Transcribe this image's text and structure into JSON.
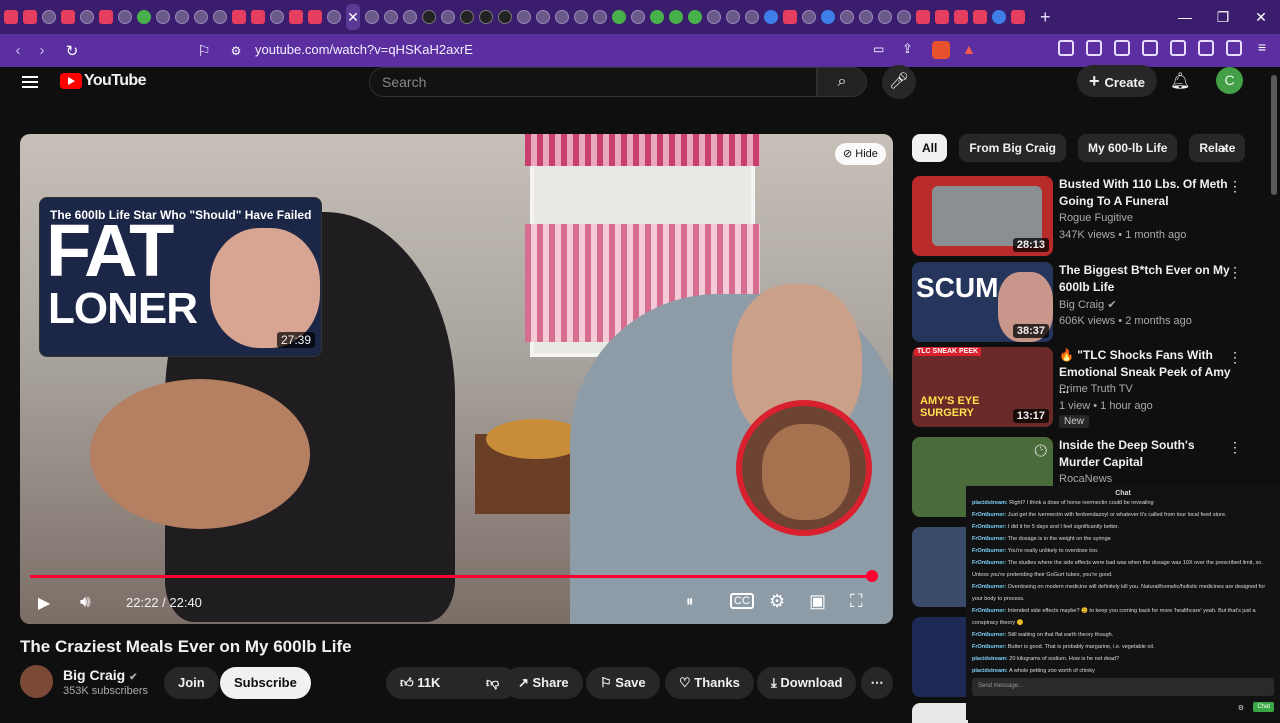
{
  "browser": {
    "url": "youtube.com/watch?v=qHSKaH2axrE",
    "new_tab": "+",
    "window_controls": [
      "—",
      "❐",
      "✕"
    ]
  },
  "header": {
    "logo": "YouTube",
    "search_placeholder": "Search",
    "create": "Create",
    "avatar_letter": "C"
  },
  "player": {
    "hide_label": "Hide",
    "overlay_title": "The 600lb Life Star Who \"Should\" Have Failed",
    "overlay_big1": "FAT",
    "overlay_big2": "LONER",
    "overlay_duration": "27:39",
    "time": "22:22 / 22:40",
    "progress": 0.986
  },
  "video": {
    "title": "The Craziest Meals Ever on My 600lb Life",
    "channel": "Big Craig",
    "subscribers": "353K subscribers",
    "join": "Join",
    "subscribe": "Subscribe",
    "likes": "11K",
    "share": "Share",
    "save": "Save",
    "thanks": "Thanks",
    "download": "Download"
  },
  "chips": [
    "All",
    "From Big Craig",
    "My 600-lb Life",
    "Relate"
  ],
  "recommendations": [
    {
      "title": "Busted With 110 Lbs. Of Meth Going To A Funeral",
      "channel": "Rogue Fugitive",
      "meta": "347K views • 1 month ago",
      "duration": "28:13",
      "thumb_color": "#b92a2a"
    },
    {
      "title": "The Biggest B*tch Ever on My 600lb Life",
      "channel": "Big Craig",
      "meta": "606K views • 2 months ago",
      "duration": "38:37",
      "thumb_color": "#25355c",
      "thumb_text": "SCUM"
    },
    {
      "title": "🔥 \"TLC Shocks Fans With Emotional Sneak Peek of Amy ...",
      "channel": "Prime Truth TV",
      "meta": "1 view • 1 hour ago",
      "duration": "13:17",
      "badge": "New",
      "thumb_color": "#a33",
      "thumb_text": "AMY'S EYE SURGERY",
      "thumb_tag": "TLC SNEAK PEEK"
    },
    {
      "title": "Inside the Deep South's Murder Capital",
      "channel": "RocaNews",
      "meta": "",
      "duration": "",
      "thumb_color": "#4a6b3a"
    }
  ],
  "chat": {
    "title": "Chat",
    "messages": [
      {
        "user": "placidstream:",
        "text": "Right? I think a dose of horse ivermectin could be revealing"
      },
      {
        "user": "FrOntburner:",
        "text": "Just get the ivermectin with fenbendazoyl or whatever it's called from tour local feed store."
      },
      {
        "user": "FrOntburner:",
        "text": "I did it for 5 days and I feel significantly better."
      },
      {
        "user": "FrOntburner:",
        "text": "The dosage is in the weight on the syringe"
      },
      {
        "user": "FrOntburner:",
        "text": "You're really unlikely to overdose too."
      },
      {
        "user": "FrOntburner:",
        "text": "The studies where the side effects were bad was when the dosage was 10X over the prescribed limit, so. Unless you're pretending their GoGurt tubes, you're good."
      },
      {
        "user": "FrOntburner:",
        "text": "Overdosing on modern medicine will definitely kill you. Natural/homelic/holistic medicines are designed for your body to process."
      },
      {
        "user": "FrOntburner:",
        "text": "Intended side effects maybe? 😉 to keep you coming back for more 'healthcare' yeah. But that's just a conspiracy theory 🤫"
      },
      {
        "user": "FrOntburner:",
        "text": "Still waiting on that flat earth theory though."
      },
      {
        "user": "FrOntburner:",
        "text": "Butter is good. That is probably margarine, i.e. vegetable oil."
      },
      {
        "user": "placidstream:",
        "text": "20 kilograms of sodium. How is he not dead?"
      },
      {
        "user": "placidstream:",
        "text": "A whole petting zoo worth of chinky"
      }
    ],
    "input_placeholder": "Send message...",
    "send": "Chat"
  }
}
